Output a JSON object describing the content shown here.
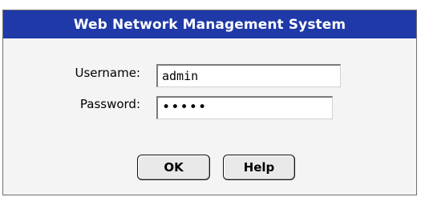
{
  "window": {
    "title": "Web Network Management System"
  },
  "form": {
    "username_label": "Username:",
    "username_value": "admin",
    "password_label": "Password:",
    "password_value": "•••••"
  },
  "buttons": {
    "ok_label": "OK",
    "help_label": "Help"
  },
  "colors": {
    "title_bar": "#1f39a8",
    "title_text": "#ffffff",
    "dialog_background": "#f4f4f4"
  }
}
